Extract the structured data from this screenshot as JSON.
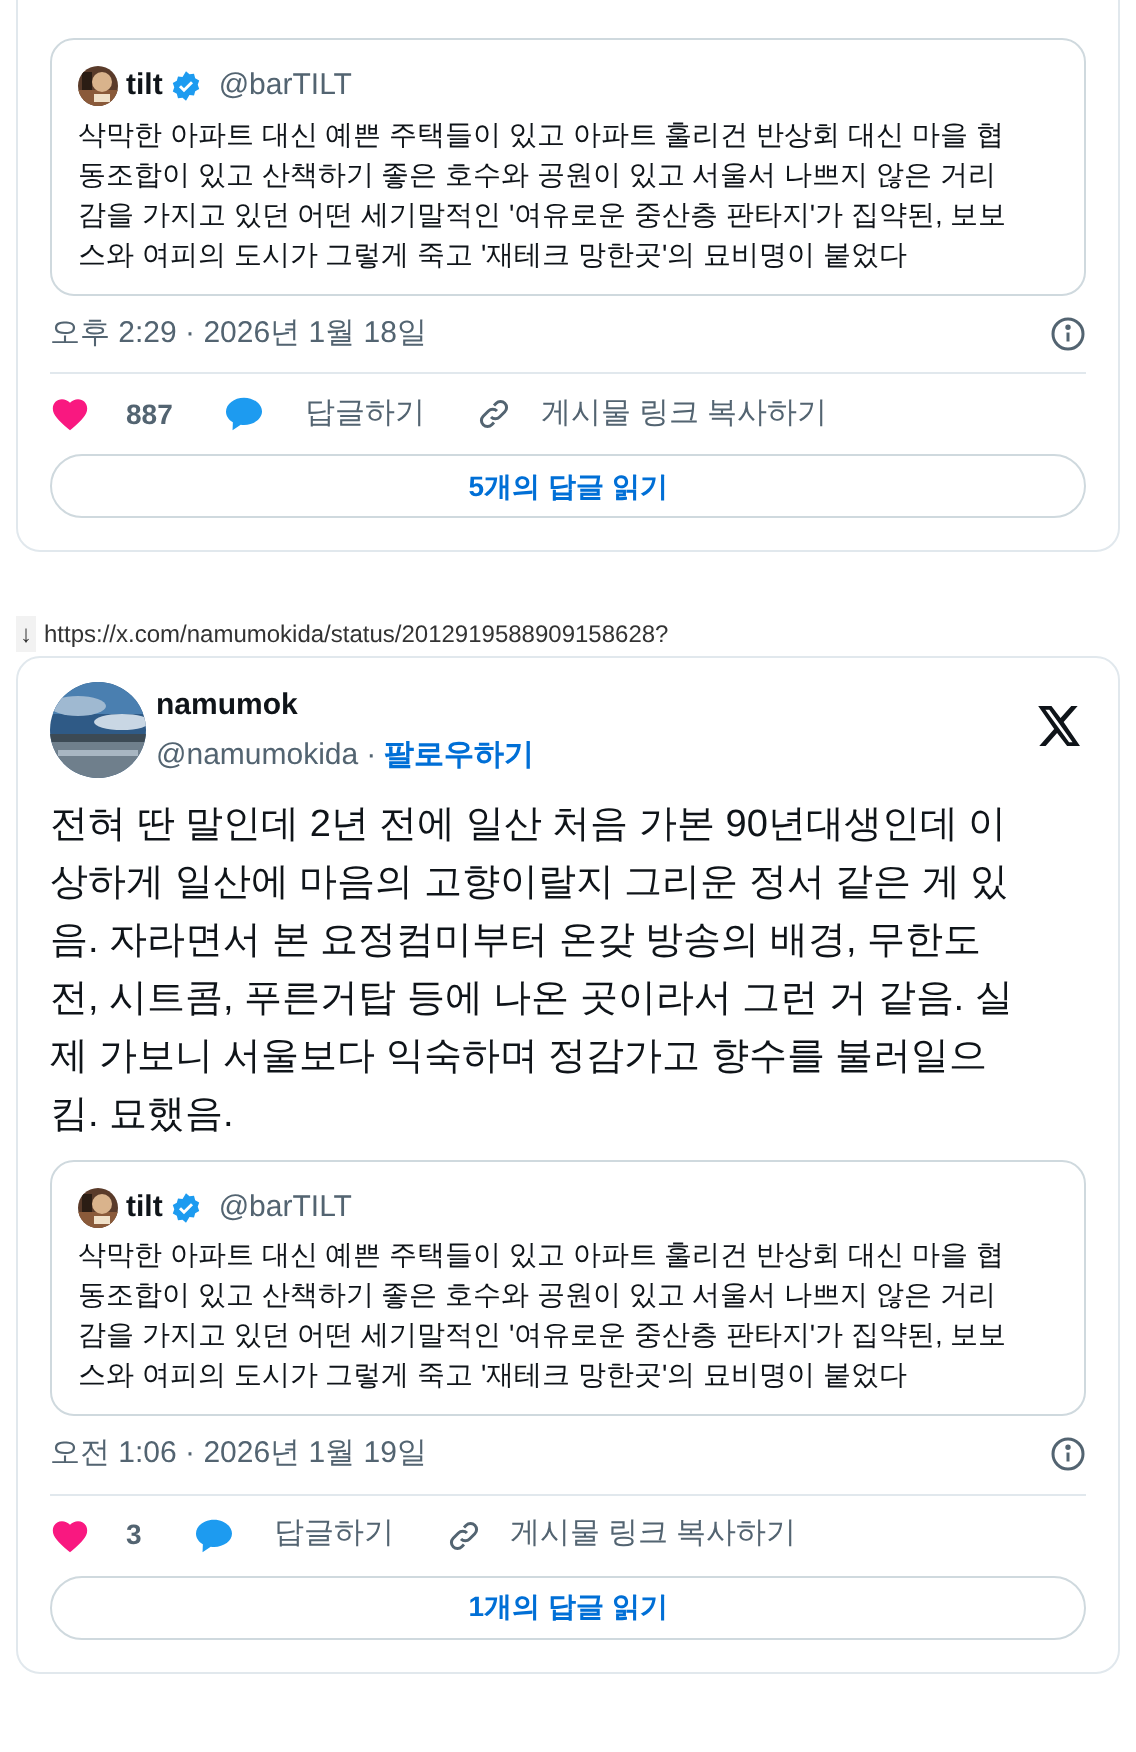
{
  "posts": [
    {
      "kind": "partial",
      "quote": {
        "name": "tilt",
        "verified": true,
        "handle": "@barTILT",
        "text": "삭막한 아파트 대신 예쁜 주택들이 있고 아파트 훌리건 반상회 대신 마을 협동조합이 있고 산책하기 좋은 호수와 공원이 있고 서울서 나쁘지 않은 거리감을 가지고 있던 어떤 세기말적인 '여유로운 중산층 판타지'가 집약된, 보보스와 여피의 도시가 그렇게 죽고 '재테크 망한곳'의 묘비명이 붙었다"
      },
      "timestamp": "오후 2:29 · 2026년 1월 18일",
      "likes": "887",
      "reply_label": "답글하기",
      "copy_label": "게시물 링크 복사하기",
      "read_replies": "5개의 답글 읽기"
    },
    {
      "kind": "full",
      "download_mark": "↓",
      "source_url": "https://x.com/namumokida/status/2012919588909158628?",
      "author": {
        "name": "namumok",
        "handle": "@namumokida",
        "separator": "·",
        "follow": "팔로우하기"
      },
      "text": "전혀 딴 말인데 2년 전에 일산 처음 가본 90년대생인데 이상하게 일산에 마음의 고향이랄지 그리운 정서 같은 게 있음. 자라면서 본 요정컴미부터 온갖 방송의 배경, 무한도전, 시트콤, 푸른거탑 등에 나온 곳이라서 그런 거 같음. 실제 가보니 서울보다 익숙하며 정감가고 향수를 불러일으킴. 묘했음.",
      "quote": {
        "name": "tilt",
        "verified": true,
        "handle": "@barTILT",
        "text": "삭막한 아파트 대신 예쁜 주택들이 있고 아파트 훌리건 반상회 대신 마을 협동조합이 있고 산책하기 좋은 호수와 공원이 있고 서울서 나쁘지 않은 거리감을 가지고 있던 어떤 세기말적인 '여유로운 중산층 판타지'가 집약된, 보보스와 여피의 도시가 그렇게 죽고 '재테크 망한곳'의 묘비명이 붙었다"
      },
      "timestamp": "오전 1:06 · 2026년 1월 19일",
      "likes": "3",
      "reply_label": "답글하기",
      "copy_label": "게시물 링크 복사하기",
      "read_replies": "1개의 답글 읽기"
    }
  ]
}
